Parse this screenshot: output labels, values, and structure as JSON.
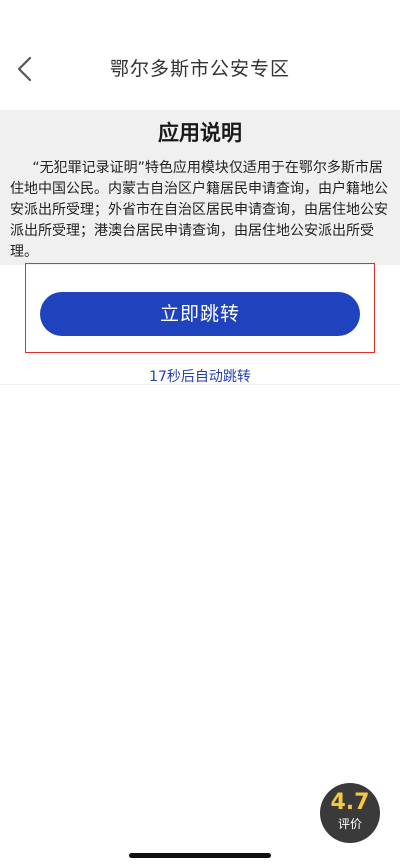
{
  "header": {
    "title": "鄂尔多斯市公安专区",
    "back_icon": "chevron-left-icon"
  },
  "notice": {
    "title": "应用说明",
    "body": "“无犯罪记录证明”特色应用模块仅适用于在鄂尔多斯市居住地中国公民。内蒙古自治区户籍居民申请查询，由户籍地公安派出所受理；外省市在自治区居民申请查询，由居住地公安派出所受理；港澳台居民申请查询，由居住地公安派出所受理。"
  },
  "action": {
    "jump_label": "立即跳转",
    "countdown_text": "17秒后自动跳转"
  },
  "rating": {
    "score": "4.7",
    "label": "评价"
  },
  "colors": {
    "primary_button": "#1f43be",
    "countdown_text": "#2340b8",
    "highlight_border": "#e0302a",
    "rating_score": "#f5c842"
  }
}
